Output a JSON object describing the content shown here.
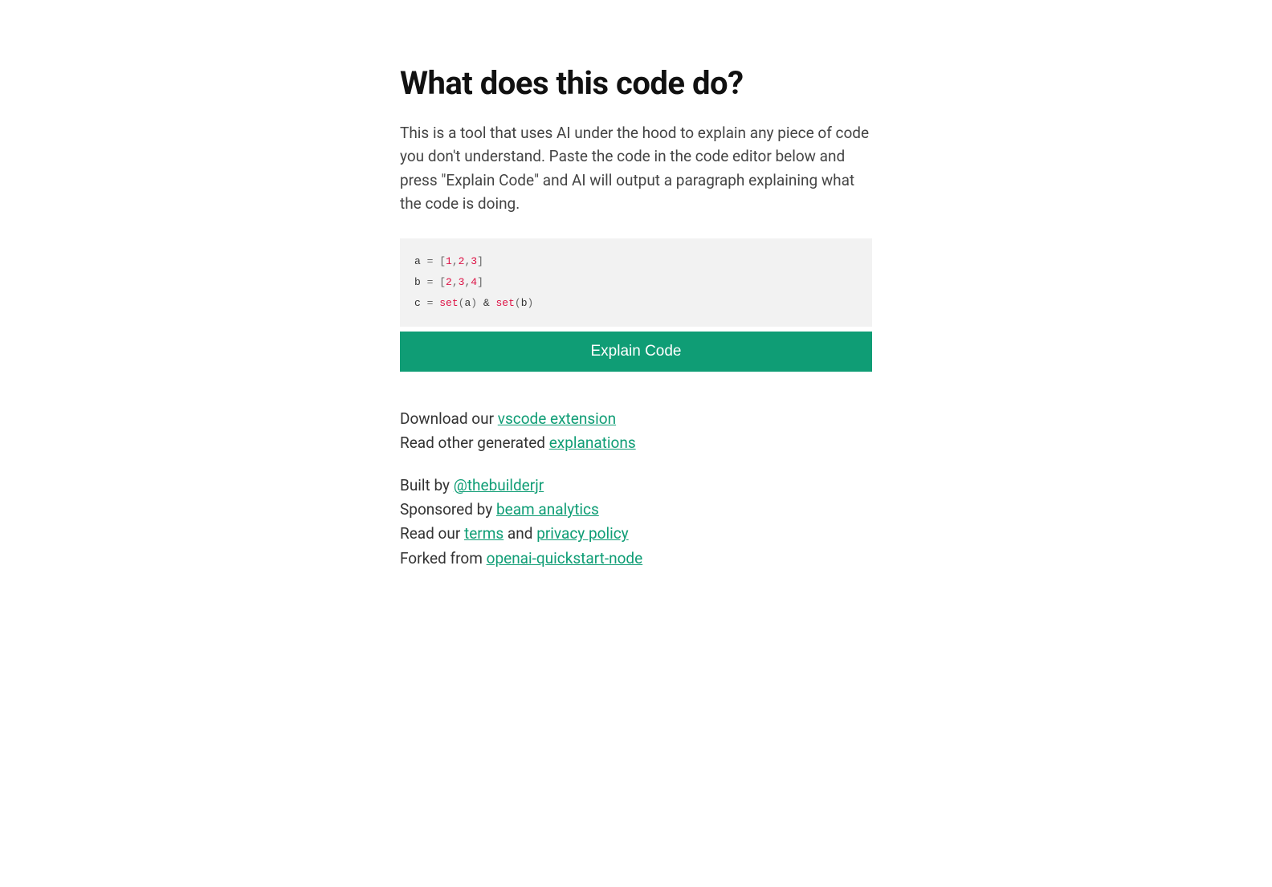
{
  "heading": "What does this code do?",
  "description": "This is a tool that uses AI under the hood to explain any piece of code you don't understand. Paste the code in the code editor below and press \"Explain Code\" and AI will output a paragraph explaining what the code is doing.",
  "code": {
    "line1": {
      "a": "a ",
      "eq": "=",
      "sp": " ",
      "lb": "[",
      "n1": "1",
      "c1": ",",
      "n2": "2",
      "c2": ",",
      "n3": "3",
      "rb": "]"
    },
    "line2": {
      "a": "b ",
      "eq": "=",
      "sp": " ",
      "lb": "[",
      "n1": "2",
      "c1": ",",
      "n2": "3",
      "c2": ",",
      "n3": "4",
      "rb": "]"
    },
    "line3": {
      "a": "c ",
      "eq": "=",
      "sp": " ",
      "set1": "set",
      "lp1": "(",
      "v1": "a",
      "rp1": ")",
      "amp": " & ",
      "set2": "set",
      "lp2": "(",
      "v2": "b",
      "rp2": ")"
    }
  },
  "button_label": "Explain Code",
  "links": {
    "download_prefix": "Download our ",
    "vscode_link": "vscode extension",
    "read_other_prefix": "Read other generated ",
    "explanations_link": "explanations",
    "built_by_prefix": "Built by ",
    "builder_link": "@thebuilderjr",
    "sponsored_prefix": "Sponsored by ",
    "sponsor_link": "beam analytics",
    "read_our_prefix": "Read our ",
    "terms_link": "terms",
    "and_text": " and ",
    "privacy_link": "privacy policy",
    "forked_prefix": "Forked from ",
    "forked_link": "openai-quickstart-node"
  }
}
